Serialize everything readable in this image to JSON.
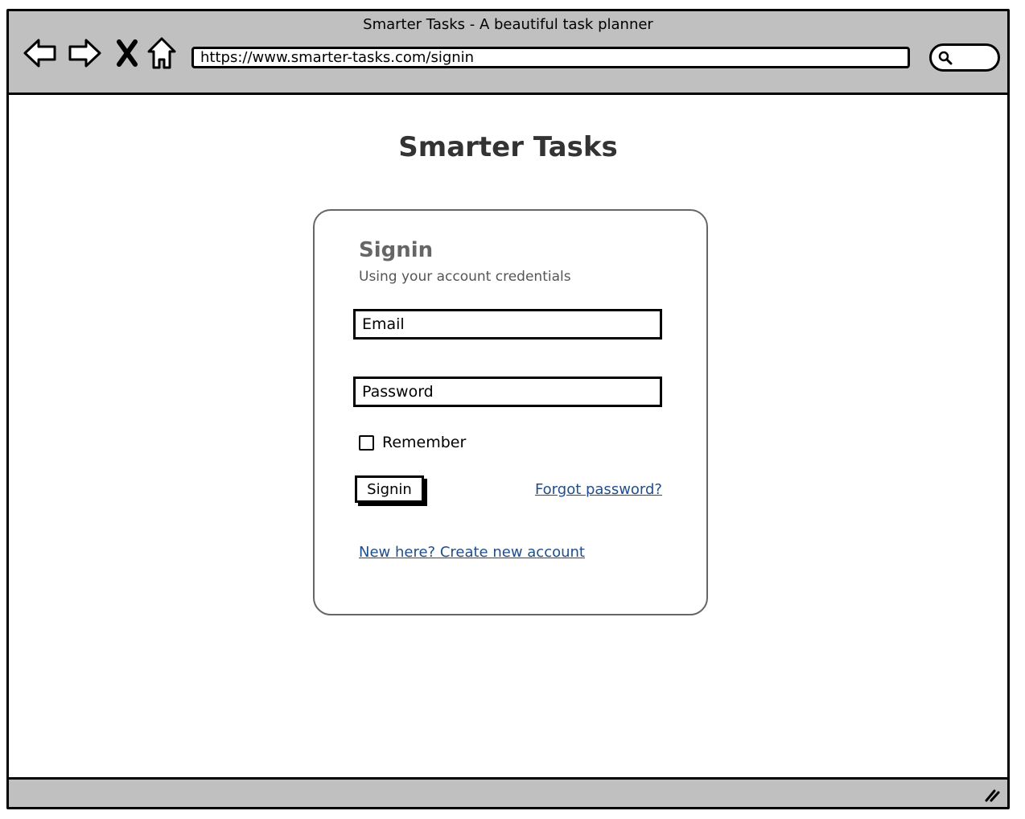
{
  "window": {
    "title": "Smarter Tasks - A beautiful task planner"
  },
  "toolbar": {
    "icons": [
      "back-arrow-icon",
      "forward-arrow-icon",
      "close-x-icon",
      "home-icon"
    ],
    "url": "https://www.smarter-tasks.com/signin",
    "search_icon": "magnifier-icon"
  },
  "page": {
    "app_title": "Smarter Tasks",
    "signin_card": {
      "heading": "Signin",
      "subheading": "Using your account credentials",
      "email_placeholder": "Email",
      "password_placeholder": "Password",
      "remember_label": "Remember",
      "remember_checked": false,
      "signin_button_label": "Signin",
      "forgot_password_link": "Forgot password?",
      "create_account_link": "New here? Create new account"
    }
  },
  "colors": {
    "chrome": "#c0c0c0",
    "link": "#1f4e8c",
    "title_text": "#333333",
    "card_heading": "#666666"
  }
}
